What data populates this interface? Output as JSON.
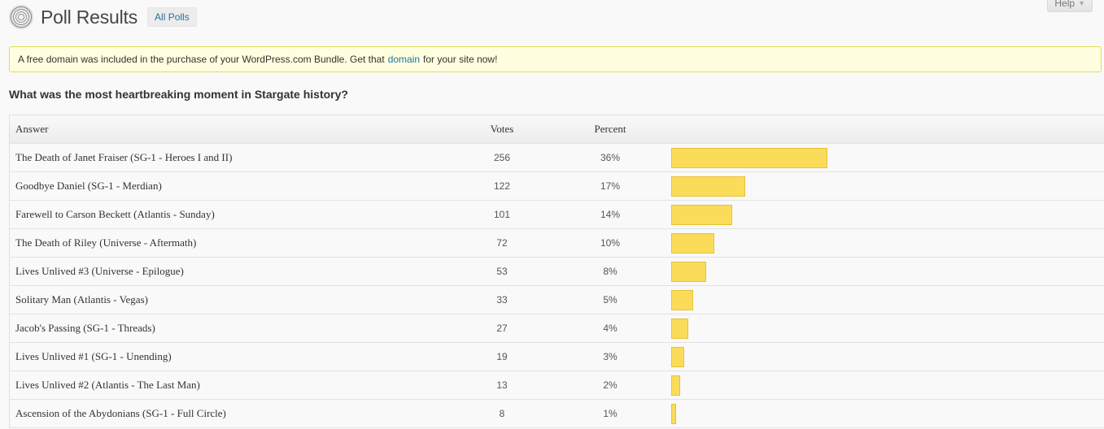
{
  "header": {
    "title": "Poll Results",
    "all_polls_label": "All Polls",
    "help_label": "Help"
  },
  "notice": {
    "text_before": "A free domain was included in the purchase of your WordPress.com Bundle. Get that",
    "link_text": "domain",
    "text_after": "for your site now!"
  },
  "poll": {
    "question": "What was the most heartbreaking moment in Stargate history?",
    "columns": {
      "answer": "Answer",
      "votes": "Votes",
      "percent": "Percent"
    },
    "bar_color": "#fbdc5a",
    "results": [
      {
        "answer": "The Death of Janet Fraiser (SG-1 - Heroes I and II)",
        "votes": "256",
        "percent": "36%",
        "share": 0.36
      },
      {
        "answer": "Goodbye Daniel (SG-1 - Merdian)",
        "votes": "122",
        "percent": "17%",
        "share": 0.17
      },
      {
        "answer": "Farewell to Carson Beckett (Atlantis - Sunday)",
        "votes": "101",
        "percent": "14%",
        "share": 0.14
      },
      {
        "answer": "The Death of Riley (Universe - Aftermath)",
        "votes": "72",
        "percent": "10%",
        "share": 0.1
      },
      {
        "answer": "Lives Unlived #3 (Universe - Epilogue)",
        "votes": "53",
        "percent": "8%",
        "share": 0.08
      },
      {
        "answer": "Solitary Man (Atlantis - Vegas)",
        "votes": "33",
        "percent": "5%",
        "share": 0.05
      },
      {
        "answer": "Jacob's Passing (SG-1 - Threads)",
        "votes": "27",
        "percent": "4%",
        "share": 0.04
      },
      {
        "answer": "Lives Unlived #1 (SG-1 - Unending)",
        "votes": "19",
        "percent": "3%",
        "share": 0.03
      },
      {
        "answer": "Lives Unlived #2 (Atlantis - The Last Man)",
        "votes": "13",
        "percent": "2%",
        "share": 0.02
      },
      {
        "answer": "Ascension of the Abydonians (SG-1 - Full Circle)",
        "votes": "8",
        "percent": "1%",
        "share": 0.01
      }
    ]
  }
}
